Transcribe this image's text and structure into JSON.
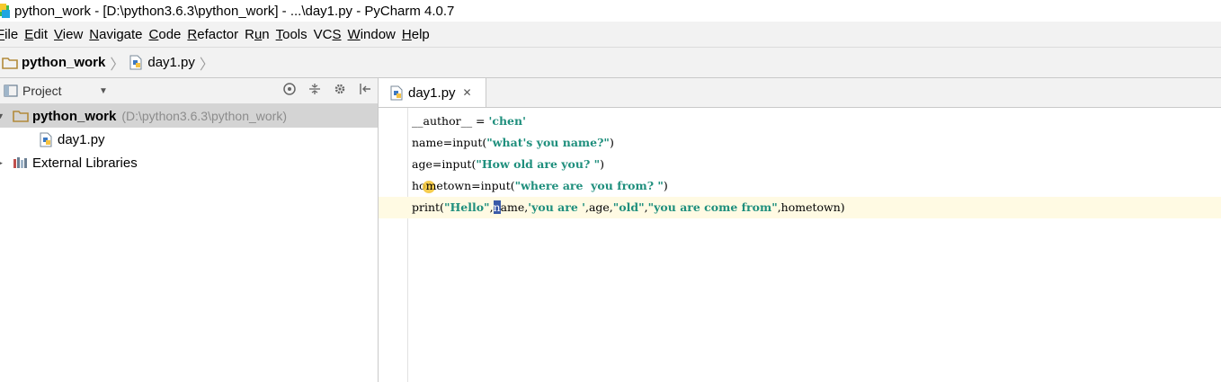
{
  "window": {
    "title": "python_work - [D:\\python3.6.3\\python_work] - ...\\day1.py - PyCharm 4.0.7"
  },
  "menu": [
    {
      "label": "File",
      "u": "F"
    },
    {
      "label": "Edit",
      "u": "E"
    },
    {
      "label": "View",
      "u": "V"
    },
    {
      "label": "Navigate",
      "u": "N"
    },
    {
      "label": "Code",
      "u": "C"
    },
    {
      "label": "Refactor",
      "u": "R"
    },
    {
      "label": "Run",
      "u": "u"
    },
    {
      "label": "Tools",
      "u": "T"
    },
    {
      "label": "VCS",
      "u": "S"
    },
    {
      "label": "Window",
      "u": "W"
    },
    {
      "label": "Help",
      "u": "H"
    }
  ],
  "breadcrumb": {
    "project": "python_work",
    "file": "day1.py",
    "separator": "〉"
  },
  "project_panel": {
    "title": "Project",
    "tree": [
      {
        "label": "python_work",
        "path": "(D:\\python3.6.3\\python_work)"
      },
      {
        "label": "day1.py"
      },
      {
        "label": "External Libraries"
      }
    ]
  },
  "editor": {
    "tab_label": "day1.py",
    "lines": [
      [
        {
          "t": "__author__ = "
        },
        {
          "t": "'chen'",
          "s": 1
        }
      ],
      [
        {
          "t": "name=input("
        },
        {
          "t": "\"what's you name?\"",
          "s": 1
        },
        {
          "t": ")"
        }
      ],
      [
        {
          "t": "age=input("
        },
        {
          "t": "\"How old are you? \"",
          "s": 1
        },
        {
          "t": ")"
        }
      ],
      [
        {
          "t": "ho"
        },
        {
          "t": "",
          "bulb": 1
        },
        {
          "t": "metown=input("
        },
        {
          "t": "\"where are  you from? \"",
          "s": 1
        },
        {
          "t": ")"
        }
      ],
      [
        {
          "t": "print("
        },
        {
          "t": "\"Hello\"",
          "s": 1
        },
        {
          "t": ","
        },
        {
          "t": "n",
          "caret": 1
        },
        {
          "t": "ame,"
        },
        {
          "t": "'you are '",
          "s": 1
        },
        {
          "t": ",age,"
        },
        {
          "t": "\"old\"",
          "s": 1
        },
        {
          "t": ","
        },
        {
          "t": "\"you are come from\"",
          "s": 1
        },
        {
          "t": ",hometown)"
        }
      ]
    ]
  },
  "colors": {
    "string": "#1f8f7d",
    "caret": "#3a5aa8",
    "current_line": "#fffae3",
    "selection": "#d4d4d4"
  }
}
